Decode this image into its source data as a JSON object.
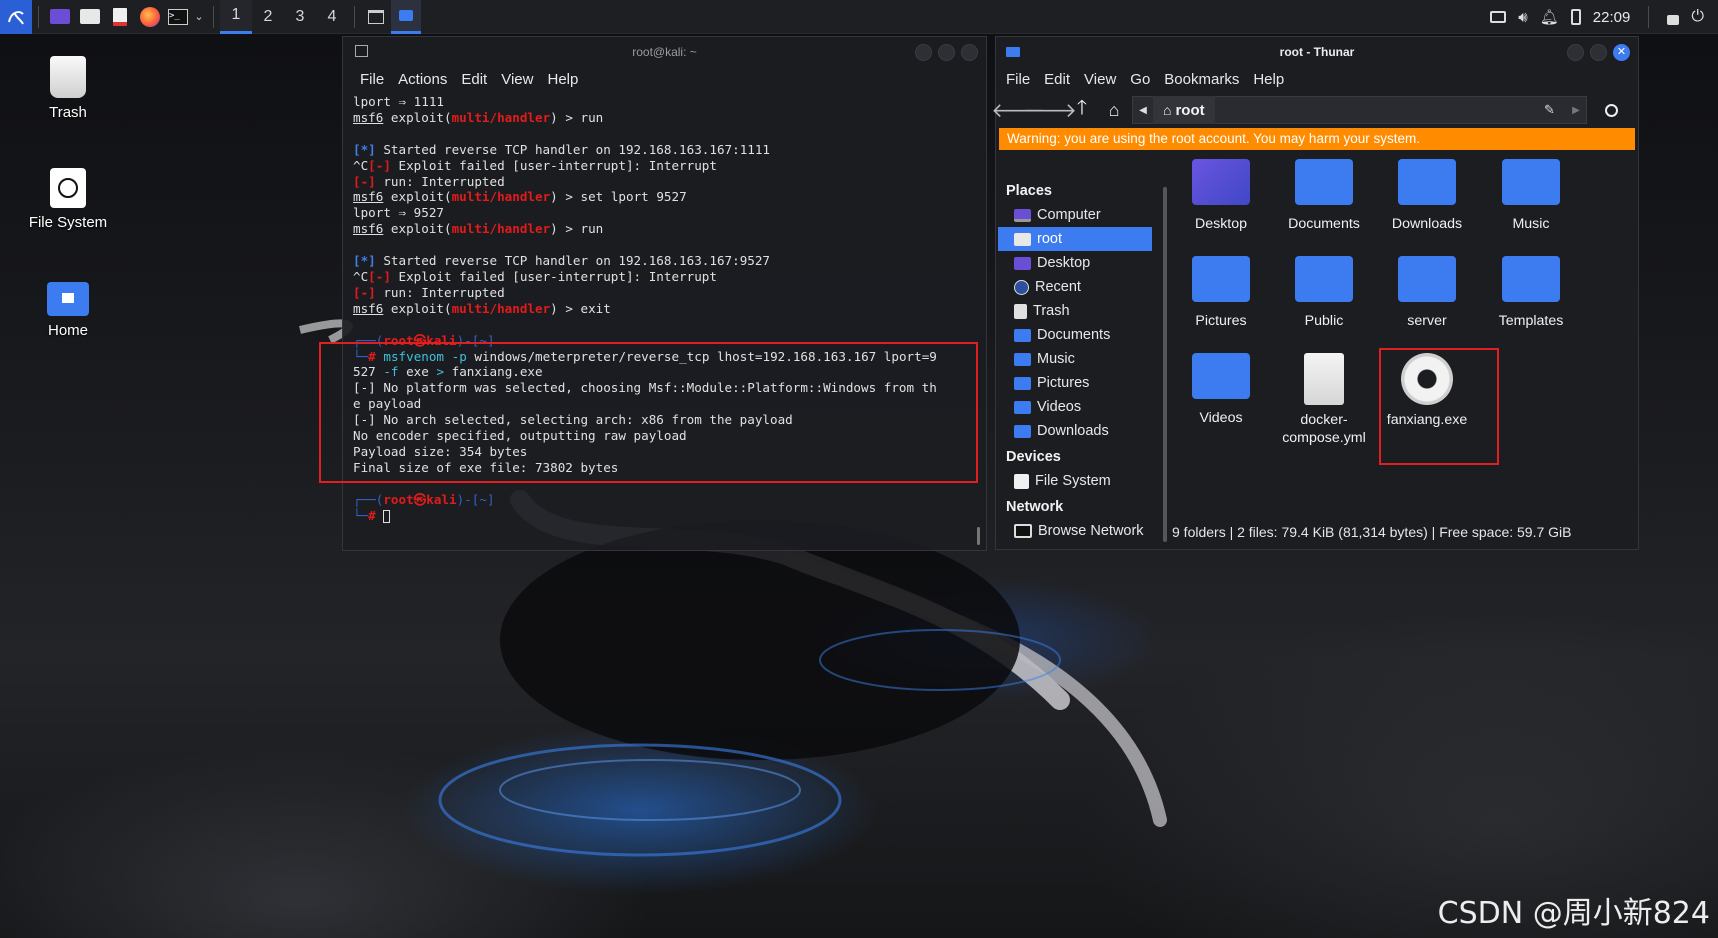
{
  "panel": {
    "workspaces": [
      "1",
      "2",
      "3",
      "4"
    ],
    "clock": "22:09"
  },
  "desktop": {
    "icons": [
      {
        "label": "Trash"
      },
      {
        "label": "File System"
      },
      {
        "label": "Home"
      }
    ]
  },
  "terminal": {
    "title": "root@kali: ~",
    "menu": [
      "File",
      "Actions",
      "Edit",
      "View",
      "Help"
    ]
  },
  "thunar": {
    "title": "root - Thunar",
    "menu": [
      "File",
      "Edit",
      "View",
      "Go",
      "Bookmarks",
      "Help"
    ],
    "path_label": "root",
    "warning": "Warning: you are using the root account. You may harm your system.",
    "places_header": "Places",
    "places": [
      "Computer",
      "root",
      "Desktop",
      "Recent",
      "Trash",
      "Documents",
      "Music",
      "Pictures",
      "Videos",
      "Downloads"
    ],
    "devices_header": "Devices",
    "devices": [
      "File System"
    ],
    "network_header": "Network",
    "network": [
      "Browse Network"
    ],
    "files": [
      "Desktop",
      "Documents",
      "Downloads",
      "Music",
      "Pictures",
      "Public",
      "server",
      "Templates",
      "Videos",
      "docker-compose.yml",
      "fanxiang.exe"
    ],
    "status": "9 folders  |  2 files: 79.4 KiB (81,314 bytes)  |  Free space: 59.7 GiB",
    "accent": "#3d7cf0",
    "warning_color": "#ff8c00"
  },
  "watermark": "CSDN @周小新824"
}
